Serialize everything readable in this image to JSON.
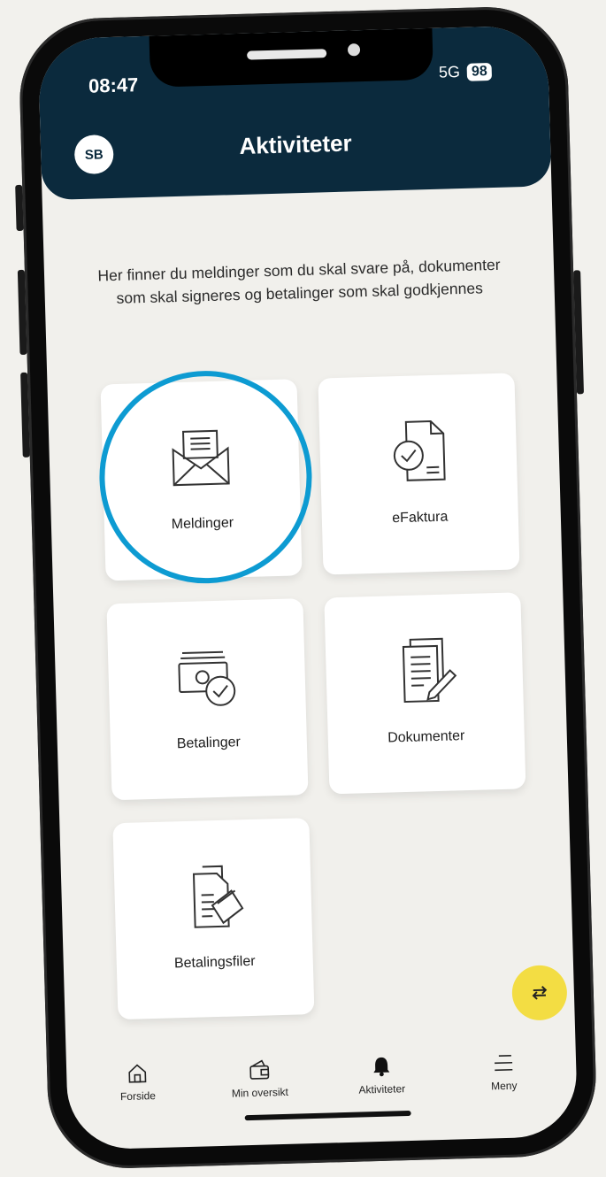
{
  "status_bar": {
    "time": "08:47",
    "network": "5G",
    "battery": "98"
  },
  "header": {
    "avatar_initials": "SB",
    "title": "Aktiviteter"
  },
  "intro_text": "Her finner du meldinger som du skal svare på, dokumenter som skal signeres og betalinger som skal godkjennes",
  "tiles": [
    {
      "label": "Meldinger",
      "icon": "envelope-icon"
    },
    {
      "label": "eFaktura",
      "icon": "invoice-check-icon"
    },
    {
      "label": "Betalinger",
      "icon": "money-check-icon"
    },
    {
      "label": "Dokumenter",
      "icon": "document-sign-icon"
    },
    {
      "label": "Betalingsfiler",
      "icon": "payment-files-icon"
    }
  ],
  "fab": {
    "icon": "swap-arrows-icon"
  },
  "bottom_nav": [
    {
      "label": "Forside",
      "icon": "home-icon"
    },
    {
      "label": "Min oversikt",
      "icon": "wallet-icon"
    },
    {
      "label": "Aktiviteter",
      "icon": "bell-icon",
      "active": true
    },
    {
      "label": "Meny",
      "icon": "menu-icon"
    }
  ],
  "colors": {
    "header": "#0b2a3d",
    "highlight_ring": "#0d9bd2",
    "fab": "#f3dd43",
    "background": "#f1f0ec"
  }
}
